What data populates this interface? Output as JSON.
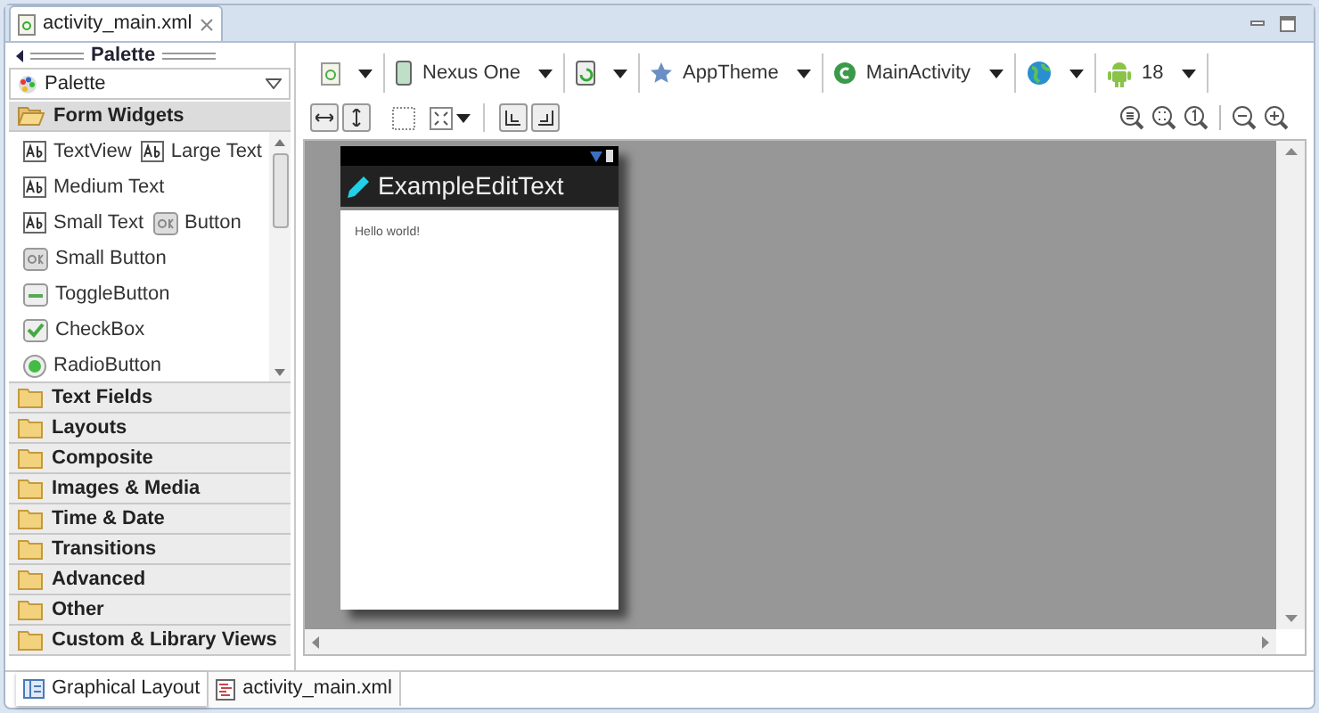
{
  "editor_tab": {
    "title": "activity_main.xml"
  },
  "palette": {
    "title": "Palette",
    "dropdown": "Palette",
    "categories": [
      {
        "label": "Form Widgets",
        "expanded": true,
        "widget_rows": [
          [
            {
              "label": "TextView",
              "kind": "ab"
            },
            {
              "label": "Large Text",
              "kind": "ab"
            }
          ],
          [
            {
              "label": "Medium Text",
              "kind": "ab"
            }
          ],
          [
            {
              "label": "Small Text",
              "kind": "ab"
            },
            {
              "label": "Button",
              "kind": "ok"
            }
          ],
          [
            {
              "label": "Small Button",
              "kind": "ok"
            }
          ],
          [
            {
              "label": "ToggleButton",
              "kind": "toggle"
            }
          ],
          [
            {
              "label": "CheckBox",
              "kind": "check"
            }
          ],
          [
            {
              "label": "RadioButton",
              "kind": "radio"
            }
          ]
        ]
      },
      {
        "label": "Text Fields",
        "expanded": false
      },
      {
        "label": "Layouts",
        "expanded": false
      },
      {
        "label": "Composite",
        "expanded": false
      },
      {
        "label": "Images & Media",
        "expanded": false
      },
      {
        "label": "Time & Date",
        "expanded": false
      },
      {
        "label": "Transitions",
        "expanded": false
      },
      {
        "label": "Advanced",
        "expanded": false
      },
      {
        "label": "Other",
        "expanded": false
      },
      {
        "label": "Custom & Library Views",
        "expanded": false
      }
    ]
  },
  "toolbar": [
    {
      "kind": "config"
    },
    {
      "kind": "device",
      "label": "Nexus One"
    },
    {
      "kind": "orientation"
    },
    {
      "kind": "theme",
      "label": "AppTheme"
    },
    {
      "kind": "activity",
      "label": "MainActivity"
    },
    {
      "kind": "locale"
    },
    {
      "kind": "api",
      "label": "18"
    }
  ],
  "preview": {
    "app_title": "ExampleEditText",
    "content": "Hello world!"
  },
  "bottom_tabs": [
    {
      "label": "Graphical Layout",
      "selected": true
    },
    {
      "label": "activity_main.xml",
      "selected": false
    }
  ]
}
